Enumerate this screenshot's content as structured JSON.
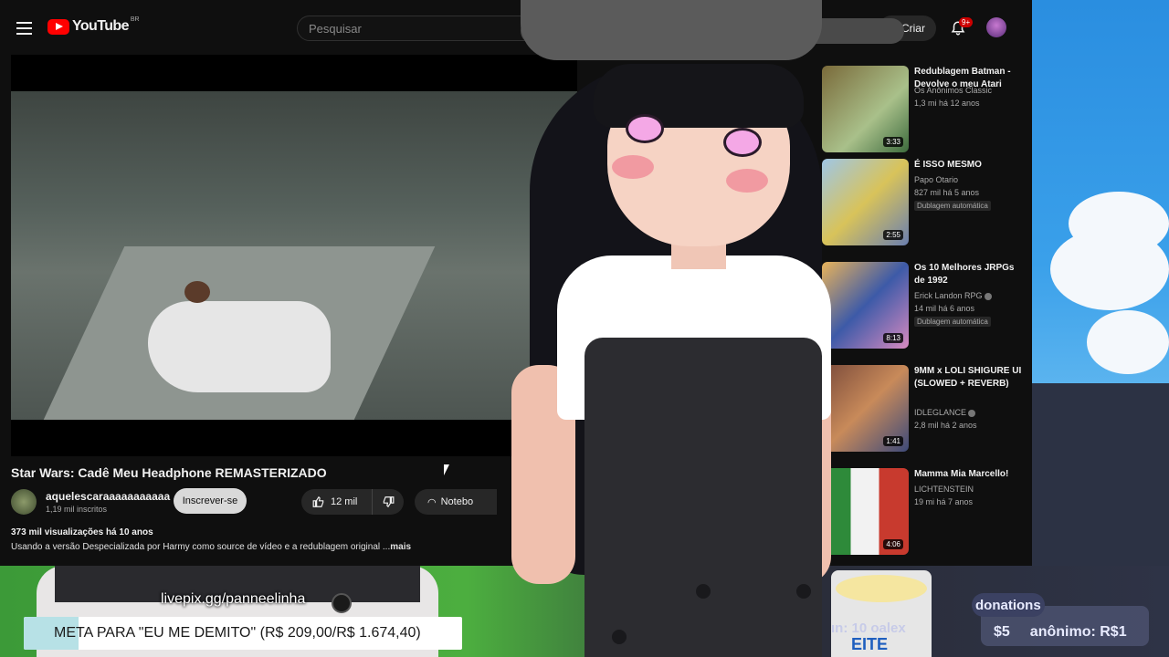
{
  "youtube": {
    "logo_text": "YouTube",
    "country_code": "BR",
    "search_placeholder": "Pesquisar",
    "create_label": "Criar",
    "notification_badge": "9+"
  },
  "video": {
    "title": "Star Wars: Cadê Meu Headphone REMASTERIZADO",
    "channel": "aquelescaraaaaaaaaaaa",
    "subscribers": "1,19 mil inscritos",
    "subscribe_label": "Inscrever-se",
    "likes": "12 mil",
    "notebook_label": "Notebo",
    "views_age": "373 mil visualizações  há 10 anos",
    "description": "Usando a versão Despecializada por Harmy como source de vídeo e a redublagem original ...",
    "more_label": "mais"
  },
  "recommendations": [
    {
      "title": "Redublagem Batman - Devolve o meu Atari",
      "channel": "Os Anônimos Classic",
      "stats": "1,3 mi  há 12 anos",
      "duration": "3:33",
      "tag": ""
    },
    {
      "title": "É ISSO MESMO",
      "channel": "Papo Otario",
      "stats": "827 mil  há 5 anos",
      "duration": "2:55",
      "tag": "Dublagem automática"
    },
    {
      "title": "Os 10 Melhores JRPGs de 1992",
      "channel": "Erick Landon RPG",
      "stats": "14 mil  há 6 anos",
      "duration": "8:13",
      "tag": "Dublagem automática"
    },
    {
      "title": "9MM x LOLI SHIGURE UI (SLOWED + REVERB)",
      "channel": "IDLEGLANCE",
      "stats": "2,8 mil  há 2 anos",
      "duration": "1:41",
      "tag": ""
    },
    {
      "title": "Mamma Mia Marcello!",
      "channel": "LICHTENSTEIN",
      "stats": "19 mi  há 7 anos",
      "duration": "4:06",
      "tag": ""
    }
  ],
  "overlay": {
    "livepix": "livepix.gg/panneelinha",
    "goal_text": "META PARA \"EU ME DEMITO\" (R$ 209,00/R$ 1.674,40)",
    "goal_progress": 0.125,
    "ticker": "ın: 10  oalex",
    "donations_label": "donations",
    "donation_amount": "$5",
    "donation_name": "anônimo: R$1",
    "bucket_label": "EITE"
  }
}
